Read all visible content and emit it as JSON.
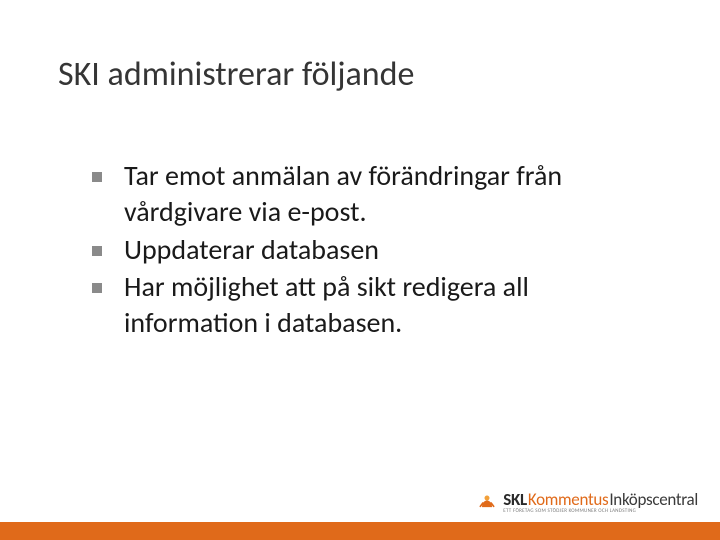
{
  "title": "SKI administrerar följande",
  "bullets": [
    "Tar emot anmälan av förändringar från vårdgivare via e-post.",
    "Uppdaterar databasen",
    "Har möjlighet att på sikt redigera all information i databasen."
  ],
  "logo": {
    "skl": "SKL",
    "kommentus": "Kommentus",
    "inkop": "Inköpscentral",
    "tagline": "ETT FÖRETAG SOM STÖDJER KOMMUNER OCH LANDSTING"
  },
  "colors": {
    "accent": "#e06a1a",
    "bullet": "#8a8a8a",
    "title": "#353535"
  }
}
